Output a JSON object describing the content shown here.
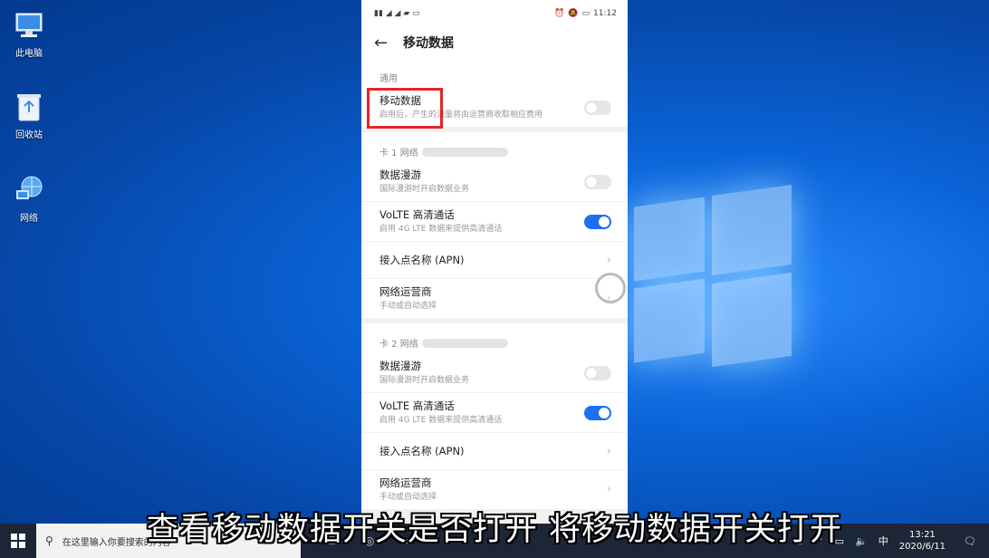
{
  "desktop": {
    "icons": [
      {
        "label": "此电脑",
        "icon": "computer-icon"
      },
      {
        "label": "回收站",
        "icon": "recycle-bin-icon"
      },
      {
        "label": "网络",
        "icon": "network-icon"
      }
    ]
  },
  "phone": {
    "status": {
      "time": "11:12"
    },
    "title": "移动数据",
    "general": {
      "header": "通用",
      "mobile_data": {
        "label": "移动数据",
        "desc": "启用后，产生的流量将由运营商收取相应费用",
        "on": false
      }
    },
    "sim1": {
      "header": "卡 1 网络",
      "roaming": {
        "label": "数据漫游",
        "desc": "国际漫游时开启数据业务",
        "on": false
      },
      "volte": {
        "label": "VoLTE 高清通话",
        "desc": "启用 4G LTE 数据来提供高清通话",
        "on": true
      },
      "apn": {
        "label": "接入点名称 (APN)"
      },
      "carrier": {
        "label": "网络运营商",
        "desc": "手动或自动选择"
      }
    },
    "sim2": {
      "header": "卡 2 网络",
      "roaming": {
        "label": "数据漫游",
        "desc": "国际漫游时开启数据业务",
        "on": false
      },
      "volte": {
        "label": "VoLTE 高清通话",
        "desc": "启用 4G LTE 数据来提供高清通话",
        "on": true
      },
      "apn": {
        "label": "接入点名称 (APN)"
      },
      "carrier": {
        "label": "网络运营商",
        "desc": "手动或自动选择"
      }
    }
  },
  "taskbar": {
    "search_placeholder": "在这里输入你要搜索的内容",
    "time": "13:21",
    "date": "2020/6/11"
  },
  "subtitle": "查看移动数据开关是否打开 将移动数据开关打开"
}
